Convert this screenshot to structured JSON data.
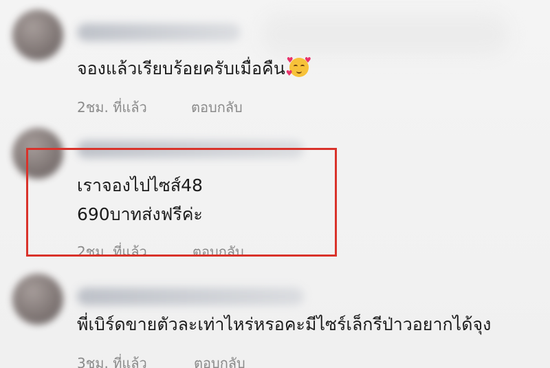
{
  "comments": [
    {
      "text": "จองแล้วเรียบร้อยครับเมื่อคืน",
      "emoji": "smiling-face-with-hearts",
      "time": "2ชม. ที่แล้ว",
      "reply": "ตอบกลับ"
    },
    {
      "line1": "เราจองไปไซส์48",
      "line2": "690บาทส่งฟรีค่ะ",
      "time": "2ชม. ที่แล้ว",
      "reply": "ตอบกลับ",
      "highlight_color": "#d9322a"
    },
    {
      "text": "พี่เบิร์ดขายตัวละเท่าไหร่หรอคะมีไซร์เล็กรีป่าวอยากได้จุง",
      "time": "3ชม. ที่แล้ว",
      "reply": "ตอบกลับ"
    }
  ]
}
